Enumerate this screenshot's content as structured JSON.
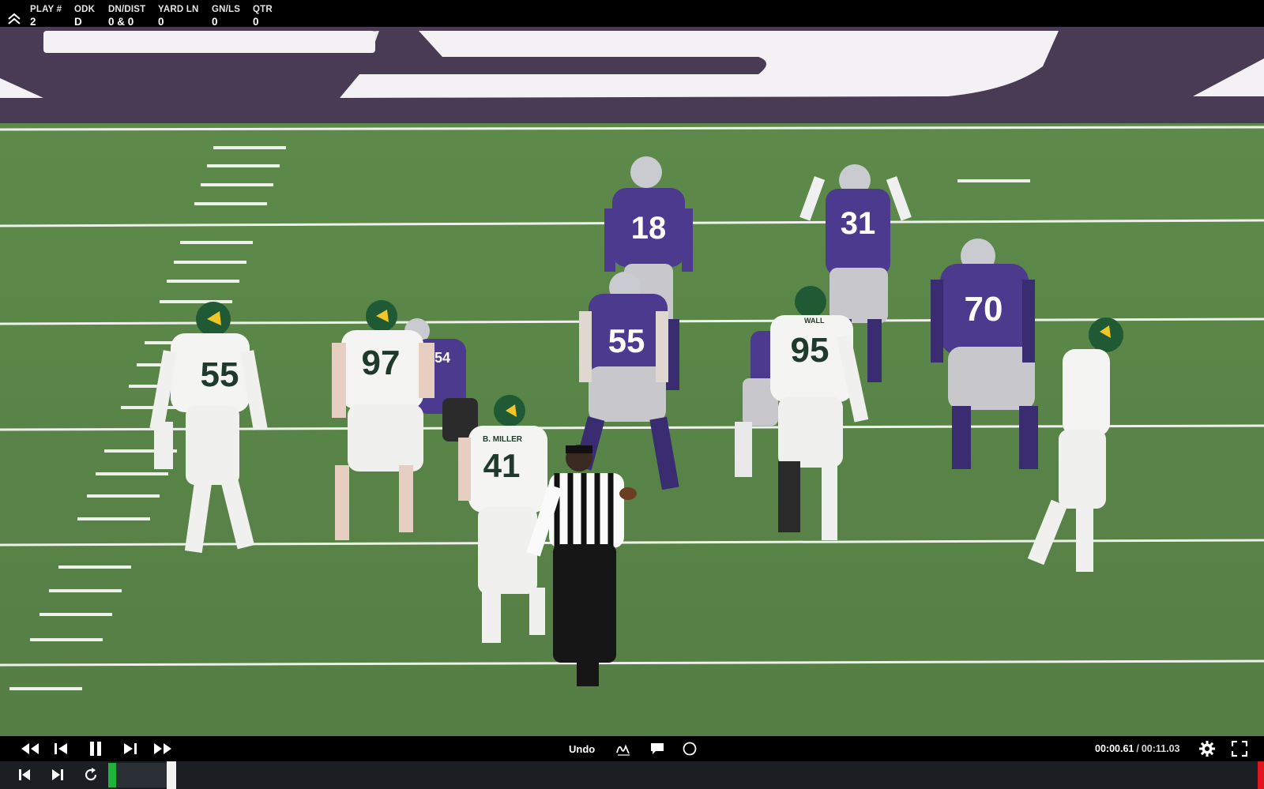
{
  "header": {
    "play_label": "PLAY #",
    "play_value": "2",
    "odk_label": "ODK",
    "odk_value": "D",
    "dndist_label": "DN/DIST",
    "dndist_value": "0 & 0",
    "yardln_label": "YARD LN",
    "yardln_value": "0",
    "gnls_label": "GN/LS",
    "gnls_value": "0",
    "qtr_label": "QTR",
    "qtr_value": "0"
  },
  "video": {
    "jerseys": {
      "qb": "18",
      "back": "31",
      "center": "55",
      "tackle": "70",
      "guard_partial": "54",
      "def_end": "55",
      "def_tackle": "97",
      "def_lb": "41",
      "def_nose": "95"
    },
    "names": {
      "lb_name": "B. MILLER",
      "nose_name": "WALL"
    },
    "colors": {
      "purple": "#4b3a8e",
      "turf": "#5a7f4a",
      "baylor_green": "#1f5a34"
    }
  },
  "controls": {
    "undo_label": "Undo",
    "current_time": "00:00.61",
    "separator": "/",
    "duration": "00:11.03",
    "icons": [
      "rewind-icon",
      "step-back-icon",
      "pause-icon",
      "step-forward-icon",
      "fast-forward-icon",
      "draw-icon",
      "comment-icon",
      "circle-icon",
      "gear-icon",
      "fullscreen-icon"
    ]
  },
  "strip": {
    "icons": [
      "skip-start-icon",
      "skip-next-icon",
      "replay-icon"
    ],
    "colors": {
      "clip": "#1fb33b",
      "end_marker": "#e0161c"
    }
  }
}
